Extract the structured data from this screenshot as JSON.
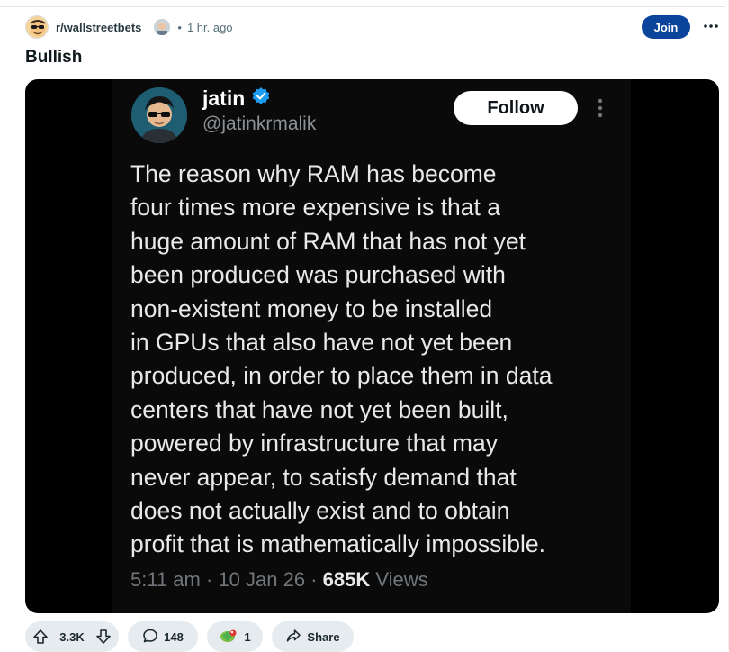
{
  "post": {
    "subreddit": "r/wallstreetbets",
    "separator": "•",
    "time_ago": "1 hr. ago",
    "join_label": "Join",
    "more_label": "⋯",
    "title": "Bullish"
  },
  "tweet": {
    "name": "jatin",
    "handle": "@jatinkrmalik",
    "follow_label": "Follow",
    "verified_icon": "verified-badge-icon",
    "lines": [
      "The reason why RAM has become",
      "four times more expensive is that a",
      "huge amount of RAM that has not yet",
      "been produced was purchased with",
      "non-existent money to be installed",
      "in GPUs that also have not yet been",
      "produced, in order to place them in data",
      "centers that have not yet been built,",
      "powered by infrastructure that may",
      "never appear, to satisfy demand that",
      "does not actually exist and to obtain",
      "profit that is mathematically impossible."
    ],
    "time": "5:11 am",
    "meta_separator": "·",
    "date": "10 Jan 26",
    "views_count": "685K",
    "views_label": "Views"
  },
  "actions": {
    "votes": "3.3K",
    "comments": "148",
    "awards": "1",
    "share_label": "Share"
  },
  "colors": {
    "join_bg": "#0a449b",
    "pill_bg": "#e5ebee",
    "verified_blue": "#1d9bf0"
  }
}
